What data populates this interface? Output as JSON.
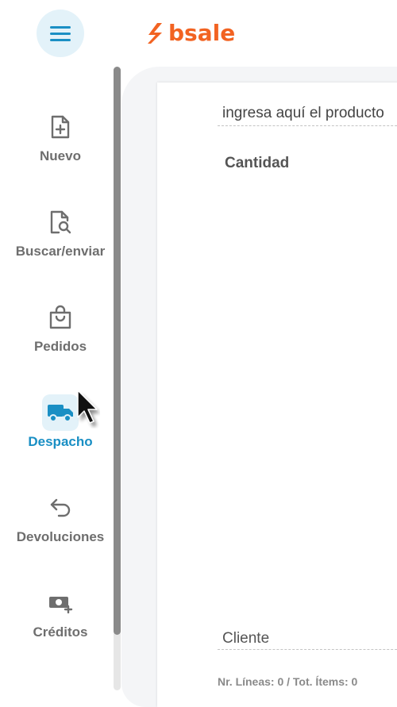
{
  "header": {
    "menu_icon": "hamburger-menu-icon",
    "logo": {
      "text": "bsale",
      "icon": "bsale-s-logo-icon",
      "color": "#f26322"
    }
  },
  "sidebar": {
    "items": [
      {
        "label": "Nuevo",
        "icon": "file-plus-icon",
        "active": false
      },
      {
        "label": "Buscar/enviar",
        "icon": "file-search-icon",
        "active": false
      },
      {
        "label": "Pedidos",
        "icon": "shopping-bag-icon",
        "active": false
      },
      {
        "label": "Despacho",
        "icon": "delivery-truck-icon",
        "active": true
      },
      {
        "label": "Devoluciones",
        "icon": "return-arrow-icon",
        "active": false
      },
      {
        "label": "Créditos",
        "icon": "cash-plus-icon",
        "active": false
      }
    ]
  },
  "main": {
    "product_search": {
      "placeholder": "ingresa aquí el producto"
    },
    "cantidad_label": "Cantidad",
    "cliente": {
      "placeholder": "Cliente"
    },
    "summary": "Nr. Líneas: 0 / Tot. Ítems: 0"
  },
  "colors": {
    "accent": "#1a8fc4",
    "accent_bg": "#e3f2f9",
    "inactive_text": "#6e6e6e",
    "brand": "#f26322"
  }
}
